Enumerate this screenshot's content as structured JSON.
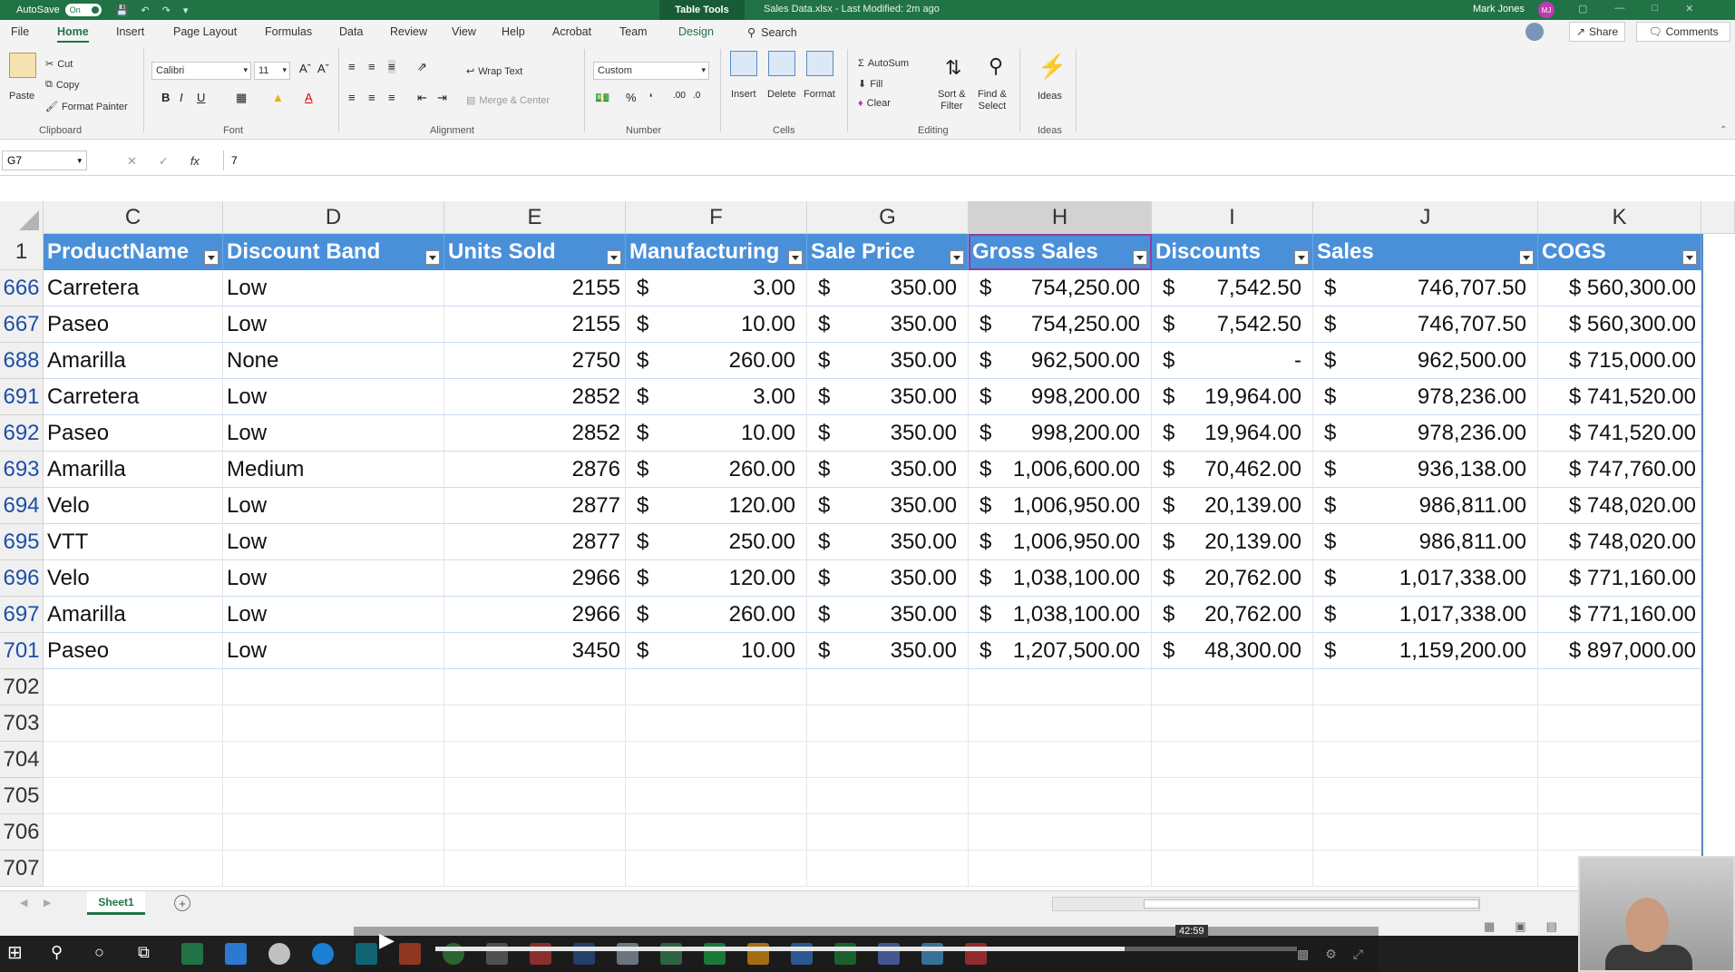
{
  "titlebar": {
    "autosave_label": "AutoSave",
    "autosave_state": "On",
    "table_tools": "Table Tools",
    "doc_title": "Sales Data.xlsx  -  Last Modified: 2m ago",
    "user_name": "Mark Jones",
    "user_initials": "MJ",
    "brand_color": "#217346"
  },
  "ribbon_tabs": [
    "File",
    "Home",
    "Insert",
    "Page Layout",
    "Formulas",
    "Data",
    "Review",
    "View",
    "Help",
    "Acrobat",
    "Team",
    "Design"
  ],
  "ribbon_tab_active": "Home",
  "search_label": "Search",
  "share_label": "Share",
  "comments_label": "Comments",
  "ribbon": {
    "paste": "Paste",
    "cut": "Cut",
    "copy": "Copy",
    "format_painter": "Format Painter",
    "clipboard": "Clipboard",
    "font_name": "Calibri",
    "font_size": "11",
    "font": "Font",
    "wrap_text": "Wrap Text",
    "merge_center": "Merge & Center",
    "alignment": "Alignment",
    "number_format": "Custom",
    "number": "Number",
    "insert": "Insert",
    "delete": "Delete",
    "format": "Format",
    "cells": "Cells",
    "autosum": "AutoSum",
    "fill": "Fill",
    "clear": "Clear",
    "sort_filter": "Sort &\nFilter",
    "find_select": "Find &\nSelect",
    "editing": "Editing",
    "ideas": "Ideas",
    "ideas_group": "Ideas"
  },
  "formula_bar": {
    "name_box": "G7",
    "fx": "fx",
    "value": "7"
  },
  "columns": [
    "C",
    "D",
    "E",
    "F",
    "G",
    "H",
    "I",
    "J",
    "K"
  ],
  "table_headers": [
    "ProductName",
    "Discount Band",
    "Units Sold",
    "Manufacturing",
    "Sale Price",
    "Gross Sales",
    "Discounts",
    "Sales",
    "COGS"
  ],
  "header_row_number": "1",
  "rows": [
    {
      "num": "666",
      "product": "Carretera",
      "band": "Low",
      "units": "2155",
      "mfg": "3.00",
      "price": "350.00",
      "gross": "754,250.00",
      "disc": "7,542.50",
      "sales": "746,707.50",
      "cogs": "$ 560,300.00"
    },
    {
      "num": "667",
      "product": "Paseo",
      "band": "Low",
      "units": "2155",
      "mfg": "10.00",
      "price": "350.00",
      "gross": "754,250.00",
      "disc": "7,542.50",
      "sales": "746,707.50",
      "cogs": "$ 560,300.00"
    },
    {
      "num": "688",
      "product": "Amarilla",
      "band": "None",
      "units": "2750",
      "mfg": "260.00",
      "price": "350.00",
      "gross": "962,500.00",
      "disc": "-",
      "sales": "962,500.00",
      "cogs": "$ 715,000.00"
    },
    {
      "num": "691",
      "product": "Carretera",
      "band": "Low",
      "units": "2852",
      "mfg": "3.00",
      "price": "350.00",
      "gross": "998,200.00",
      "disc": "19,964.00",
      "sales": "978,236.00",
      "cogs": "$ 741,520.00"
    },
    {
      "num": "692",
      "product": "Paseo",
      "band": "Low",
      "units": "2852",
      "mfg": "10.00",
      "price": "350.00",
      "gross": "998,200.00",
      "disc": "19,964.00",
      "sales": "978,236.00",
      "cogs": "$ 741,520.00"
    },
    {
      "num": "693",
      "product": "Amarilla",
      "band": "Medium",
      "units": "2876",
      "mfg": "260.00",
      "price": "350.00",
      "gross": "1,006,600.00",
      "disc": "70,462.00",
      "sales": "936,138.00",
      "cogs": "$ 747,760.00"
    },
    {
      "num": "694",
      "product": "Velo",
      "band": "Low",
      "units": "2877",
      "mfg": "120.00",
      "price": "350.00",
      "gross": "1,006,950.00",
      "disc": "20,139.00",
      "sales": "986,811.00",
      "cogs": "$ 748,020.00"
    },
    {
      "num": "695",
      "product": "VTT",
      "band": "Low",
      "units": "2877",
      "mfg": "250.00",
      "price": "350.00",
      "gross": "1,006,950.00",
      "disc": "20,139.00",
      "sales": "986,811.00",
      "cogs": "$ 748,020.00"
    },
    {
      "num": "696",
      "product": "Velo",
      "band": "Low",
      "units": "2966",
      "mfg": "120.00",
      "price": "350.00",
      "gross": "1,038,100.00",
      "disc": "20,762.00",
      "sales": "1,017,338.00",
      "cogs": "$ 771,160.00"
    },
    {
      "num": "697",
      "product": "Amarilla",
      "band": "Low",
      "units": "2966",
      "mfg": "260.00",
      "price": "350.00",
      "gross": "1,038,100.00",
      "disc": "20,762.00",
      "sales": "1,017,338.00",
      "cogs": "$ 771,160.00"
    },
    {
      "num": "701",
      "product": "Paseo",
      "band": "Low",
      "units": "3450",
      "mfg": "10.00",
      "price": "350.00",
      "gross": "1,207,500.00",
      "disc": "48,300.00",
      "sales": "1,159,200.00",
      "cogs": "$ 897,000.00"
    }
  ],
  "currency_symbol": "$",
  "empty_rows": [
    "702",
    "703",
    "704",
    "705",
    "706",
    "707"
  ],
  "sheet_tab": "Sheet1",
  "video": {
    "time": "42:59",
    "progress": 0.8
  }
}
